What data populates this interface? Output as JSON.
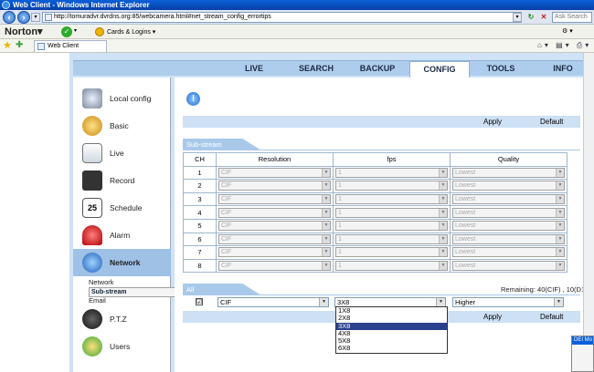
{
  "browser": {
    "window_title": "Web Client - Windows Internet Explorer",
    "url": "http://tomuradvr.dvrdns.org:85/webcamera.html#net_stream_config_errortips",
    "search_placeholder": "Ask Search",
    "norton_label": "Norton",
    "cards_label": "Cards & Logins",
    "tab_title": "Web Client"
  },
  "nav": {
    "tabs": [
      "LIVE",
      "SEARCH",
      "BACKUP",
      "CONFIG",
      "TOOLS",
      "INFO"
    ],
    "active": "CONFIG"
  },
  "sidebar": {
    "items": [
      "Local config",
      "Basic",
      "Live",
      "Record",
      "Schedule",
      "Alarm",
      "Network",
      "P.T.Z",
      "Users"
    ],
    "active": "Network",
    "subitems": [
      "Network",
      "Sub-stream",
      "Email"
    ],
    "active_sub": "Sub-stream"
  },
  "toolbar": {
    "apply_label": "Apply",
    "default_label": "Default"
  },
  "substream": {
    "section_title": "Sub-stream",
    "headers": [
      "CH",
      "Resolution",
      "fps",
      "Quality"
    ],
    "rows": [
      {
        "ch": "1",
        "resolution": "CIF",
        "fps": "1",
        "quality": "Lowest"
      },
      {
        "ch": "2",
        "resolution": "CIF",
        "fps": "1",
        "quality": "Lowest"
      },
      {
        "ch": "3",
        "resolution": "CIF",
        "fps": "1",
        "quality": "Lowest"
      },
      {
        "ch": "4",
        "resolution": "CIF",
        "fps": "1",
        "quality": "Lowest"
      },
      {
        "ch": "5",
        "resolution": "CIF",
        "fps": "1",
        "quality": "Lowest"
      },
      {
        "ch": "6",
        "resolution": "CIF",
        "fps": "1",
        "quality": "Lowest"
      },
      {
        "ch": "7",
        "resolution": "CIF",
        "fps": "1",
        "quality": "Lowest"
      },
      {
        "ch": "8",
        "resolution": "CIF",
        "fps": "1",
        "quality": "Lowest"
      }
    ]
  },
  "all": {
    "section_title": "All",
    "remaining": "Remaining: 40(CIF) , 10(D1).",
    "checkbox": "☑",
    "resolution": "CIF",
    "fps": "3X8",
    "quality": "Higher",
    "fps_options": [
      "1X8",
      "2X8",
      "3X8",
      "4X8",
      "5X8",
      "6X8"
    ],
    "fps_highlighted": "3X8"
  },
  "popup_title": "DEI Mo"
}
